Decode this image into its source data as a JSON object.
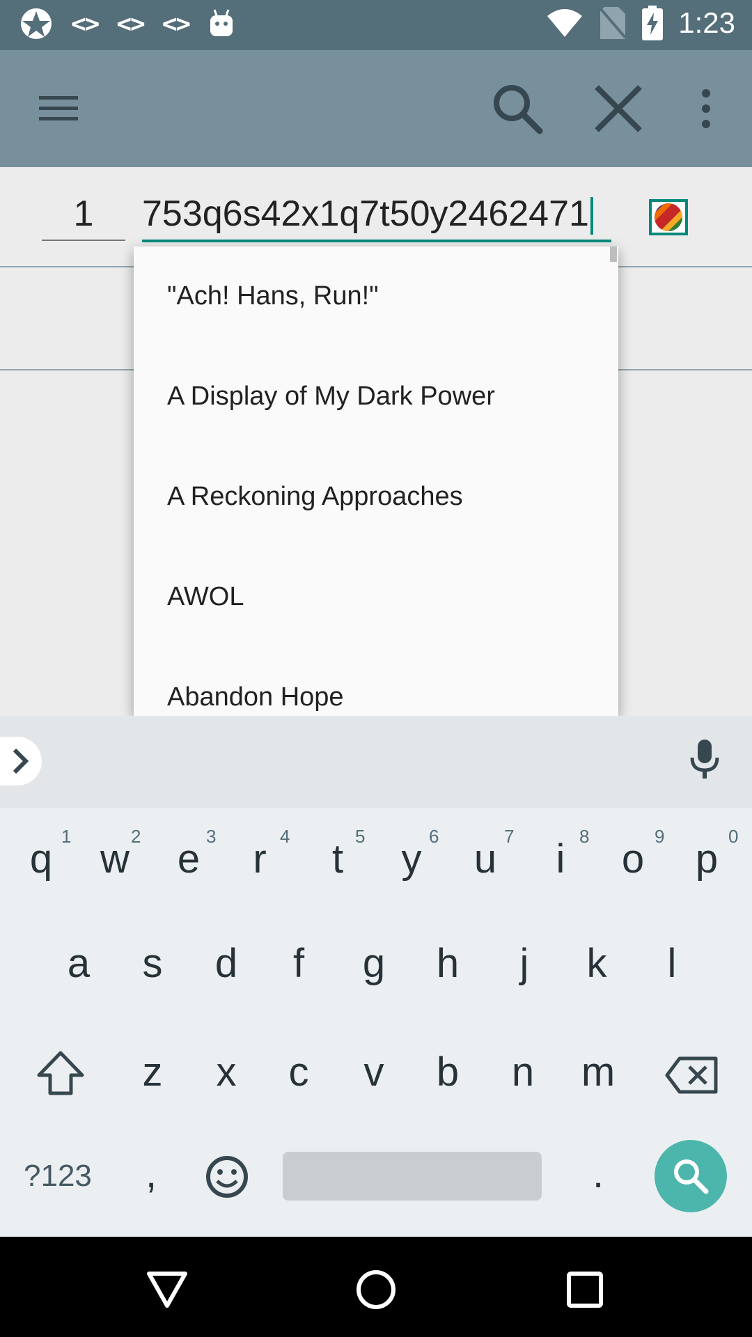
{
  "status_bar": {
    "time": "1:23",
    "left_icons": [
      "app-star-icon",
      "code-icon",
      "code-icon",
      "code-icon",
      "android-icon"
    ],
    "right_icons": [
      "wifi-icon",
      "no-sim-icon",
      "battery-charging-icon"
    ],
    "code_glyph": "<>"
  },
  "toolbar": {
    "icons": [
      "menu-icon",
      "search-icon",
      "close-icon",
      "more-vert-icon"
    ],
    "background": "#78909c"
  },
  "form": {
    "number_value": "1",
    "query_value": "753q6s42x1q7t50y2462471",
    "accent": "#00897b"
  },
  "dropdown": {
    "items": [
      "\"Ach! Hans, Run!\"",
      "A Display of My Dark Power",
      "A Reckoning Approaches",
      "AWOL",
      "Abandon Hope"
    ]
  },
  "keyboard": {
    "row1": [
      "q",
      "w",
      "e",
      "r",
      "t",
      "y",
      "u",
      "i",
      "o",
      "p"
    ],
    "row1_hints": [
      "1",
      "2",
      "3",
      "4",
      "5",
      "6",
      "7",
      "8",
      "9",
      "0"
    ],
    "row2": [
      "a",
      "s",
      "d",
      "f",
      "g",
      "h",
      "j",
      "k",
      "l"
    ],
    "row3": [
      "z",
      "x",
      "c",
      "v",
      "b",
      "n",
      "m"
    ],
    "symbols_key": "?123",
    "comma_key": ",",
    "period_key": ".",
    "fab_color": "#4db6ac"
  },
  "nav_bar": {
    "icons": [
      "back-icon",
      "home-icon",
      "recents-icon"
    ]
  }
}
